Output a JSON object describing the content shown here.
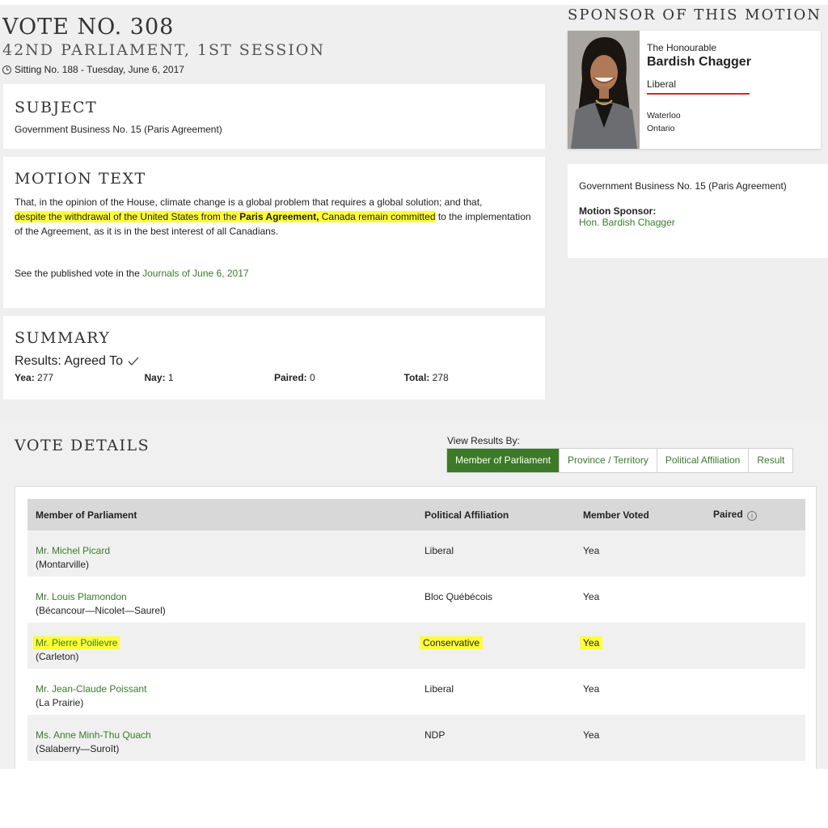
{
  "vote": {
    "title": "VOTE NO. 308",
    "session": "42ND PARLIAMENT, 1ST SESSION",
    "sitting": "Sitting No. 188 - Tuesday, June 6, 2017"
  },
  "subject": {
    "heading": "SUBJECT",
    "text": "Government Business No. 15 (Paris Agreement)"
  },
  "motion": {
    "heading": "MOTION TEXT",
    "part1": "That, in the opinion of the House, climate change is a global problem that requires a global solution; and that,",
    "part2": "despite the withdrawal of the United States from the ",
    "part3_bold": "Paris Agreement,",
    "part4": " Canada remain committed",
    "part5": " to the implementation of the Agreement, as it is in the best interest of all Canadians.",
    "journals_prefix": "See the published vote in the ",
    "journals_link": "Journals of June 6, 2017"
  },
  "summary": {
    "heading": "SUMMARY",
    "result": "Results: Agreed To",
    "yea_label": "Yea:",
    "yea_value": "277",
    "nay_label": "Nay:",
    "nay_value": "1",
    "paired_label": "Paired:",
    "paired_value": "0",
    "total_label": "Total:",
    "total_value": "278"
  },
  "sponsor": {
    "heading": "SPONSOR OF THIS MOTION",
    "title": "The Honourable",
    "name": "Bardish Chagger",
    "party": "Liberal",
    "riding": "Waterloo",
    "province": "Ontario",
    "party_color": "#d3282f"
  },
  "sponsor_summary": {
    "subject": "Government Business No. 15 (Paris Agreement)",
    "label": "Motion Sponsor:",
    "link": "Hon. Bardish Chagger"
  },
  "vote_details": {
    "heading": "VOTE DETAILS",
    "view_by_label": "View Results By:",
    "tabs": [
      "Member of Parliament",
      "Province / Territory",
      "Political Affiliation",
      "Result"
    ],
    "columns": [
      "Member of Parliament",
      "Political Affiliation",
      "Member Voted",
      "Paired"
    ],
    "rows": [
      {
        "name": "Mr. Michel Picard",
        "riding": "(Montarville)",
        "affiliation": "Liberal",
        "vote": "Yea"
      },
      {
        "name": "Mr. Louis Plamondon",
        "riding": "(Bécancour—Nicolet—Saurel)",
        "affiliation": "Bloc Québécois",
        "vote": "Yea"
      },
      {
        "name": "Mr. Pierre Poilievre",
        "riding": "(Carleton)",
        "affiliation": "Conservative",
        "vote": "Yea"
      },
      {
        "name": "Mr. Jean-Claude Poissant",
        "riding": "(La Prairie)",
        "affiliation": "Liberal",
        "vote": "Yea"
      },
      {
        "name": "Ms. Anne Minh-Thu Quach",
        "riding": "(Salaberry—Suroît)",
        "affiliation": "NDP",
        "vote": "Yea"
      }
    ]
  },
  "colors": {
    "accent_green": "#3d7a27",
    "link_green": "#3a7a2c",
    "highlight": "#fffd38"
  }
}
